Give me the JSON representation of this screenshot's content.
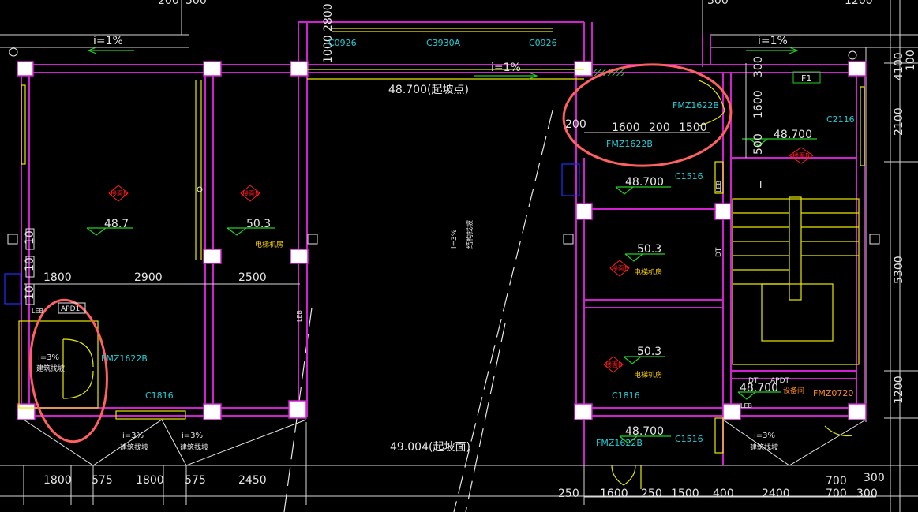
{
  "colors": {
    "background": "#000000",
    "wall": "#d020d0",
    "dimension": "#e6e6e6",
    "annotation": "#1ecfd6",
    "room_label": "#ffd400",
    "highlight_circle": "#ff6060",
    "section_mark": "#ff2020"
  },
  "top_dims": {
    "d1": "200",
    "d2": "500",
    "d3": "1000",
    "d4": "300",
    "d5": "1200",
    "d6": "2800"
  },
  "windows": {
    "c0926_left": "C0926",
    "c3930a": "C3930A",
    "c0926_right": "C0926",
    "c2116": "C2116",
    "c1516_a": "C1516",
    "c1516_b": "C1516",
    "c1816_a": "C1816",
    "c1816_b": "C1816"
  },
  "doors": {
    "fmz1622b_a": "FMZ1622B",
    "fmz1622b_b": "FMZ1622B",
    "fmz1622b_c": "FMZ1622B",
    "fmz1622b_d": "FMZ1622B",
    "fmz0720": "FMZ0720"
  },
  "slopes": {
    "top_left": "i=1%",
    "top_mid": "i=1%",
    "top_right": "i=1%",
    "left_door": "i=3%",
    "bottom_1": "i=3%",
    "bottom_2": "i=3%",
    "bottom_3": "i=3%",
    "ramp": "i=3%"
  },
  "slope_notes": {
    "left_door": "建筑找坡",
    "bottom_1": "建筑找坡",
    "bottom_2": "建筑找坡",
    "bottom_3": "建筑找坡",
    "ramp": "结构找坡"
  },
  "elevations": {
    "start_slope": "48.700(起坡点)",
    "end_slope": "49.004(起坡面)",
    "room_487": "48.7",
    "room_503_a": "50.3",
    "room_503_b": "50.3",
    "room_503_c": "50.3",
    "room_48700_a": "48.700",
    "room_48700_b": "48.700",
    "room_48700_c": "48.700",
    "room_48700_d": "48.700"
  },
  "room_names": {
    "machine_a": "电梯机房",
    "machine_b": "电梯机房",
    "machine_c": "电梯机房",
    "equipment": "设备间"
  },
  "section_tags": {
    "a": "楼面B",
    "b": "楼面B",
    "c": "楼面B",
    "d": "楼面B",
    "e": "楼面B"
  },
  "labels": {
    "f1": "F1",
    "t": "T",
    "lEB": "LEB",
    "dt": "DT",
    "apdt": "APDT",
    "apd1": "APD1"
  },
  "right_dims": {
    "r4100": "4100",
    "r100": "100",
    "r2100": "2100",
    "r5300": "5300",
    "r1200": "1200"
  },
  "inner_dims": {
    "i300": "300",
    "i1600v": "1600",
    "i500": "500",
    "i200l": "200",
    "i1600h": "1600",
    "i200m": "200",
    "i1500": "1500"
  },
  "mid_dims": {
    "m1800": "1800",
    "m2900": "2900",
    "m2500": "2500"
  },
  "bottom_dims": {
    "b1800a": "1800",
    "b575a": "575",
    "b1800b": "1800",
    "b575b": "575",
    "b2450": "2450",
    "b250a": "250",
    "b1600": "1600",
    "b250b": "250",
    "b1500": "1500",
    "b400": "400",
    "b2400": "2400",
    "b700a": "700",
    "b700b": "700",
    "b300a": "300",
    "b300b": "300"
  },
  "left_dims": {
    "l10a": "10",
    "l10b": "10",
    "l10c": "10"
  }
}
